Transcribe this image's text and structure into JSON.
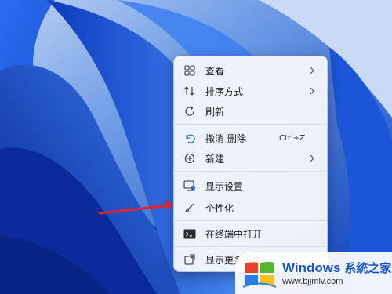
{
  "context_menu": {
    "items": [
      {
        "label": "查看",
        "icon": "grid-view-icon",
        "has_submenu": true
      },
      {
        "label": "排序方式",
        "icon": "sort-arrows-icon",
        "has_submenu": true
      },
      {
        "label": "刷新",
        "icon": "refresh-icon",
        "has_submenu": false
      },
      {
        "label": "撤消 删除",
        "icon": "undo-icon",
        "shortcut": "Ctrl+Z"
      },
      {
        "label": "新建",
        "icon": "new-plus-icon",
        "has_submenu": true
      },
      {
        "label": "显示设置",
        "icon": "display-settings-icon"
      },
      {
        "label": "个性化",
        "icon": "brush-icon"
      },
      {
        "label": "在终端中打开",
        "icon": "terminal-icon"
      },
      {
        "label": "显示更多选项",
        "icon": "more-options-icon"
      }
    ]
  },
  "watermark": {
    "title": "Windows",
    "title_cn": "系统之家",
    "url": "www.bjjmlv.com"
  },
  "colors": {
    "wallpaper": "#0a3fc4",
    "menu_bg": "#f3f6fb",
    "annotation_arrow": "#e8202a",
    "watermark_text": "#1a56c9"
  }
}
